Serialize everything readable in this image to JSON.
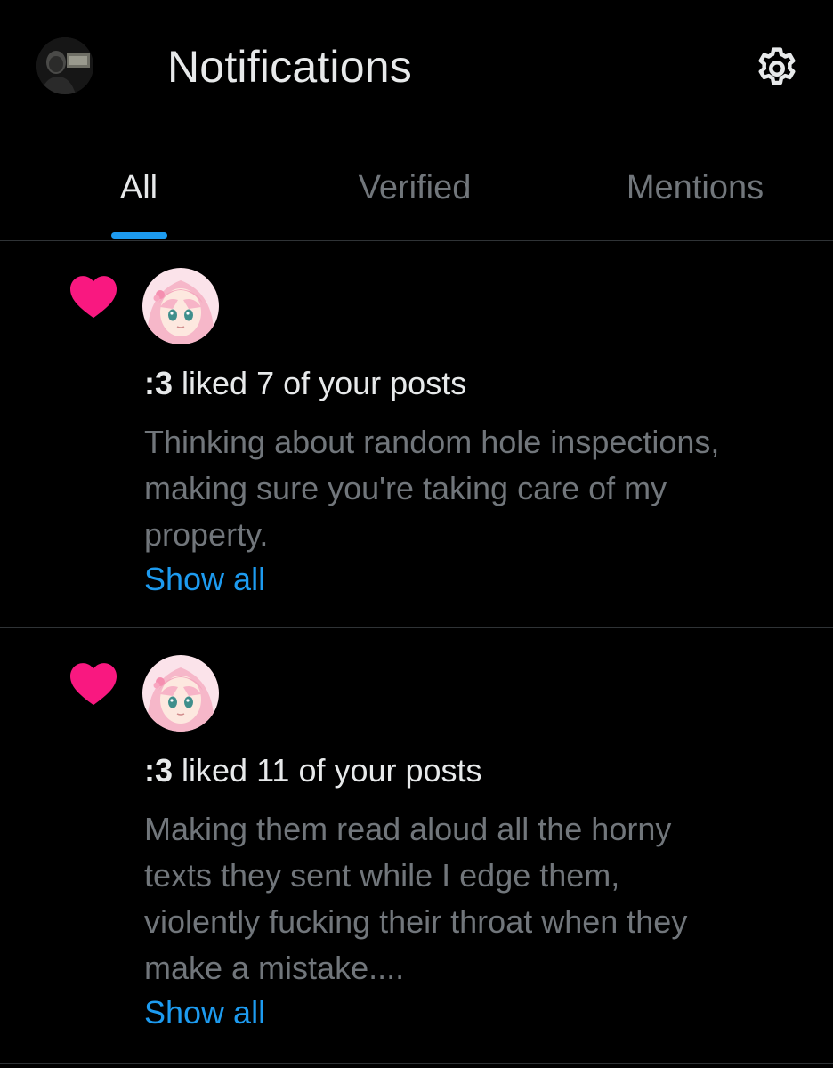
{
  "header": {
    "title": "Notifications",
    "avatar_icon": "user-avatar",
    "settings_icon": "gear-icon"
  },
  "tabs": [
    {
      "label": "All",
      "active": true
    },
    {
      "label": "Verified",
      "active": false
    },
    {
      "label": "Mentions",
      "active": false
    }
  ],
  "notifications": [
    {
      "type_icon": "heart-icon",
      "actor": ":3",
      "action": "liked 7 of your posts",
      "text_lines": [
        "Thinking about random hole inspections,",
        "making sure you're taking care of my",
        "property."
      ],
      "show_all": "Show all"
    },
    {
      "type_icon": "heart-icon",
      "actor": ":3",
      "action": "liked 11 of your posts",
      "text_lines": [
        "Making them read aloud all the horny",
        "texts they sent while I edge them,",
        "violently fucking their throat when they",
        "make a mistake...."
      ],
      "show_all": "Show all"
    }
  ],
  "colors": {
    "background": "#000000",
    "text_primary": "#e7e9ea",
    "text_secondary": "#71767b",
    "accent": "#1d9bf0",
    "like": "#f91880",
    "divider": "#2f3336"
  }
}
